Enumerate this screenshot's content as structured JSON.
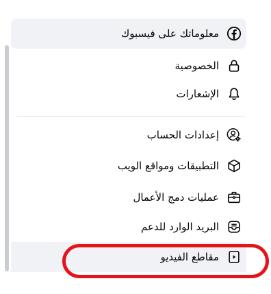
{
  "menu": {
    "facebook_info": {
      "label": "معلوماتك على فيسبوك",
      "icon": "facebook-icon"
    },
    "privacy": {
      "label": "الخصوصية",
      "icon": "lock-icon"
    },
    "notifications": {
      "label": "الإشعارات",
      "icon": "bell-icon"
    },
    "account_settings": {
      "label": "إعدادات الحساب",
      "icon": "user-gear-icon"
    },
    "apps_websites": {
      "label": "التطبيقات ومواقع الويب",
      "icon": "cube-icon"
    },
    "business_integrations": {
      "label": "عمليات دمج الأعمال",
      "icon": "briefcase-icon"
    },
    "support_inbox": {
      "label": "البريد الوارد للدعم",
      "icon": "inbox-icon"
    },
    "videos": {
      "label": "مقاطع الفيديو",
      "icon": "video-icon"
    }
  },
  "colors": {
    "highlight": "#f0f2f5",
    "annotation": "#e3141b",
    "text": "#050505"
  }
}
